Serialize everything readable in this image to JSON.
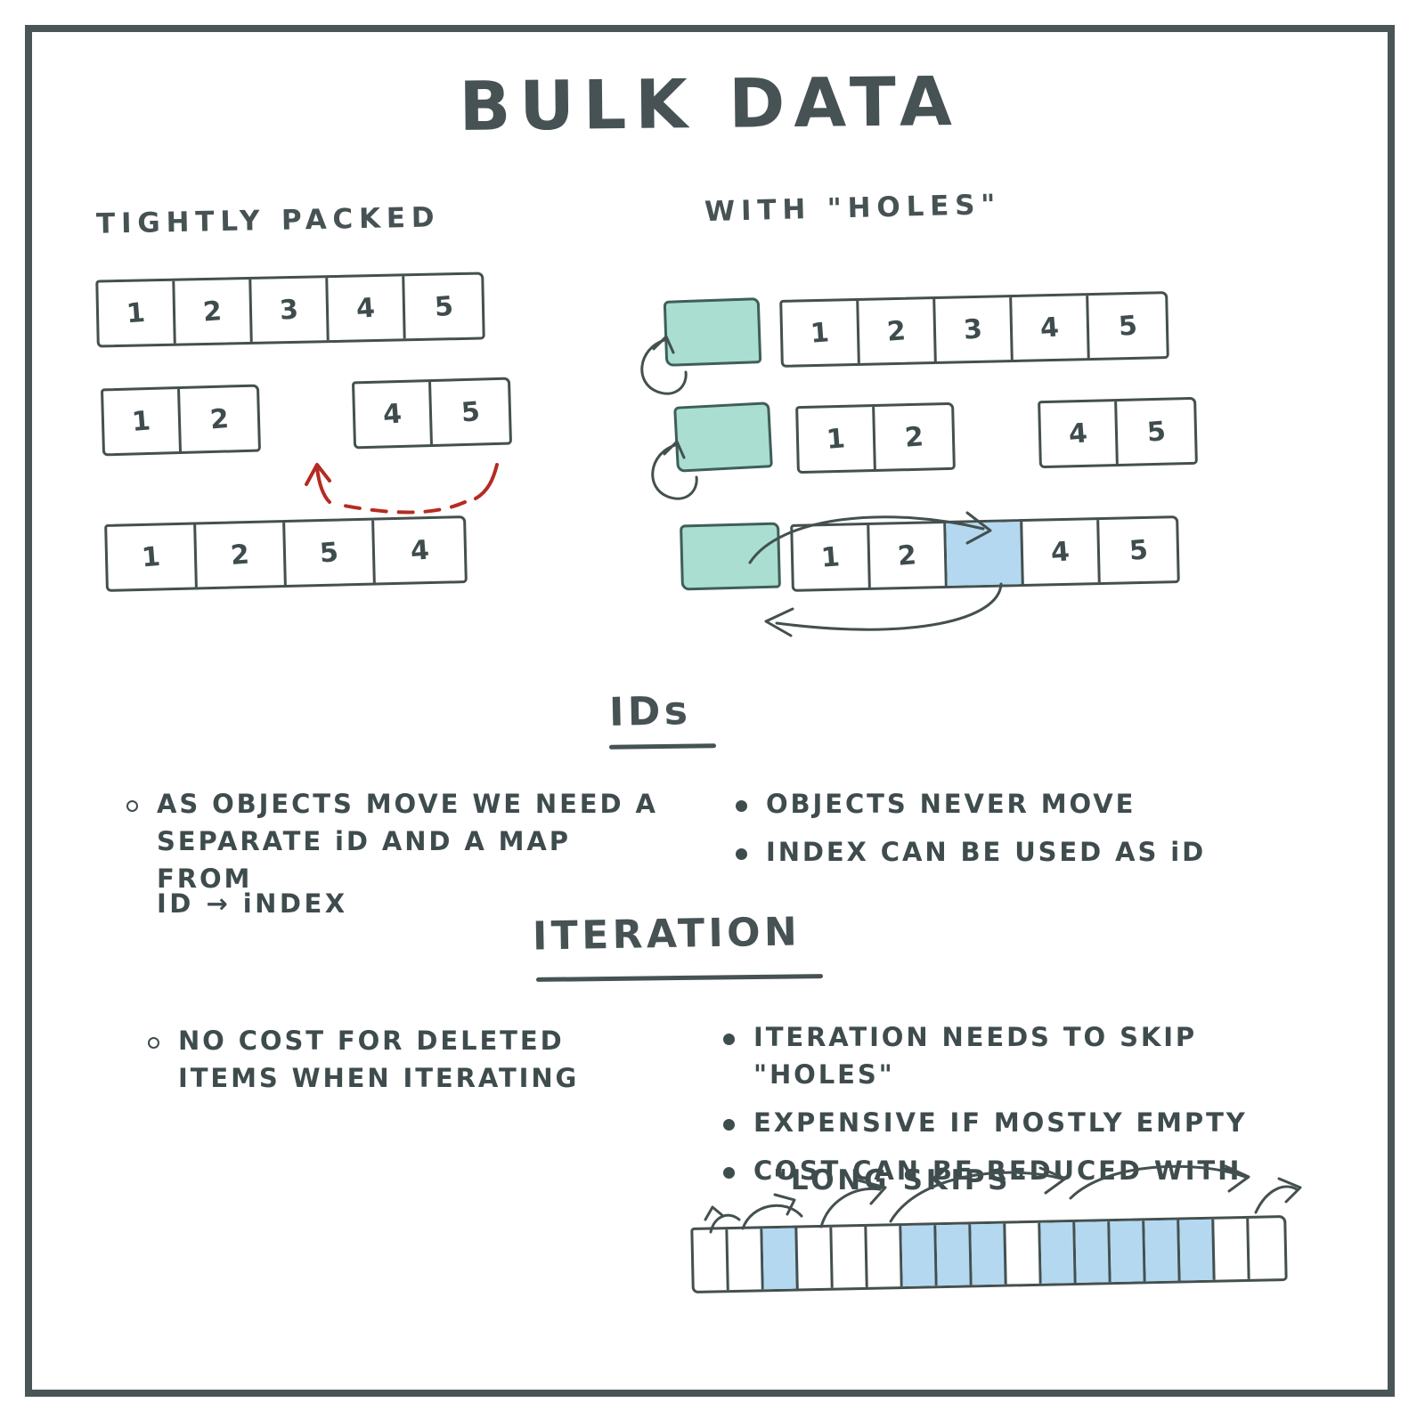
{
  "title": "BULK DATA",
  "columns": {
    "left_header": "TIGHTLY   PACKED",
    "right_header": "WITH \"HOLES\""
  },
  "tightly_packed": {
    "rows": [
      {
        "label": "initial-array",
        "cells": [
          "1",
          "2",
          "3",
          "4",
          "5"
        ]
      },
      {
        "label": "after-delete-array",
        "left_cells": [
          "1",
          "2"
        ],
        "right_cells": [
          "4",
          "5"
        ],
        "gap_note": "element 3 removed leaves a gap"
      },
      {
        "label": "after-swap-array",
        "cells": [
          "1",
          "2",
          "5",
          "4"
        ]
      }
    ],
    "move_arrow_note": "last element swapped into the gap"
  },
  "with_holes": {
    "rows": [
      {
        "label": "initial-array",
        "free_head": "",
        "cells": [
          "1",
          "2",
          "3",
          "4",
          "5"
        ]
      },
      {
        "label": "after-delete-array",
        "free_head": "",
        "left_cells": [
          "1",
          "2"
        ],
        "right_cells": [
          "4",
          "5"
        ]
      },
      {
        "label": "freelist-linked-array",
        "free_head": "",
        "cells": [
          "1",
          "2",
          "",
          "4",
          "5"
        ],
        "hole_index": 2
      }
    ]
  },
  "ids_section": {
    "heading": "IDs",
    "left_bullets": [
      "AS OBJECTS MOVE WE NEED A\nSEPARATE iD AND A MAP FROM"
    ],
    "left_extra_line": "ID  →   iNDEX",
    "right_bullets": [
      "OBJECTS NEVER MOVE",
      "INDEX CAN BE USED AS iD"
    ]
  },
  "iteration_section": {
    "heading": "ITERATION",
    "left_bullets": [
      "NO COST FOR DELETED\nITEMS WHEN ITERATING"
    ],
    "right_bullets": [
      "ITERATION NEEDS TO SKIP \"HOLES\"",
      "EXPENSIVE IF MOSTLY EMPTY",
      "COST CAN BE REDUCED WITH"
    ],
    "right_sub_line": "\"LONG SKIPS\""
  },
  "long_skips_strip": {
    "cell_count": 17,
    "blue_cells": [
      3,
      8,
      9,
      10,
      12,
      13,
      14,
      15,
      16
    ],
    "skip_arcs": [
      {
        "from_cell": 1,
        "to_cell": 2,
        "span": 1
      },
      {
        "from_cell": 2,
        "to_cell": 4,
        "span": 2
      },
      {
        "from_cell": 4,
        "to_cell": 7,
        "span": 3
      },
      {
        "from_cell": 7,
        "to_cell": 12,
        "span": 5
      },
      {
        "from_cell": 15,
        "to_cell": 17,
        "span": 2
      }
    ]
  },
  "colors": {
    "ink": "#44504f",
    "frame": "#4a5557",
    "free_slot_teal": "#a9ded1",
    "hole_blue": "#b4d8f0",
    "move_arrow_red": "#b52b22",
    "background": "#ffffff"
  }
}
